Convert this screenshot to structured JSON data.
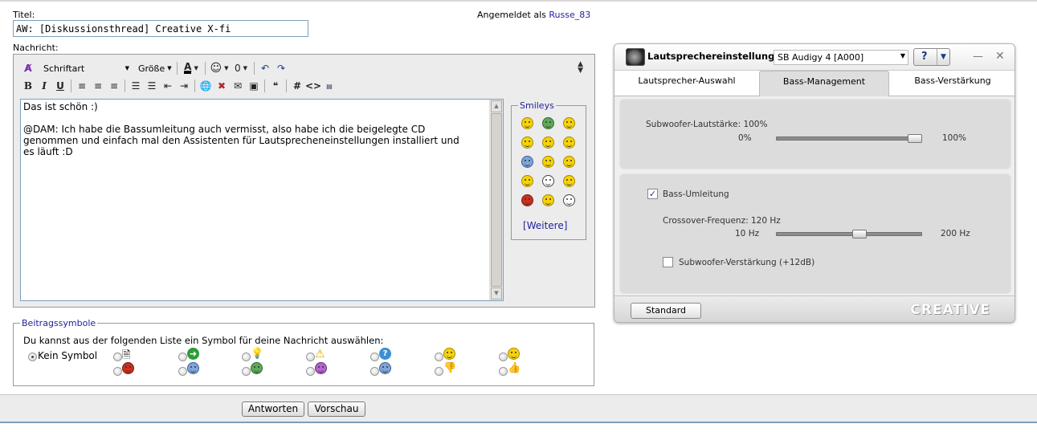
{
  "form": {
    "title_label": "Titel:",
    "title_value": "AW: [Diskussionsthread] Creative X-fi",
    "message_label": "Nachricht:",
    "logged_in_prefix": "Angemeldet als",
    "username": "Russe_83"
  },
  "toolbar": {
    "font_label": "Schriftart",
    "size_label": "Größe",
    "code_hash": "#",
    "code_tags": "<>"
  },
  "message": {
    "lines": [
      "Das ist schön :)",
      "",
      "@DAM: Ich habe die Bassumleitung auch vermisst, also habe ich die beigelegte CD",
      "genommen und einfach mal den Assistenten für Lautsprecheneinstellungen installiert und",
      "es läuft :D"
    ]
  },
  "smileys": {
    "legend": "Smileys",
    "more_bracket_open": "[",
    "more_label": "Weitere",
    "more_bracket_close": "]"
  },
  "post_icons": {
    "legend": "Beitragssymbole",
    "description": "Du kannst aus der folgenden Liste ein Symbol für deine Nachricht auswählen:",
    "no_symbol_label": "Kein Symbol"
  },
  "buttons": {
    "reply": "Antworten",
    "preview": "Vorschau"
  },
  "speaker_window": {
    "title": "Lautsprechereinstellungen",
    "device": "SB Audigy 4 [A000]",
    "help": "?",
    "tabs": [
      "Lautsprecher-Auswahl",
      "Bass-Management",
      "Bass-Verstärkung"
    ],
    "active_tab": "Bass-Management",
    "subwoofer_volume_label": "Subwoofer-Lautstärke: 100%",
    "subwoofer_min": "0%",
    "subwoofer_max": "100%",
    "subwoofer_level": 1.0,
    "bass_redirect_label": "Bass-Umleitung",
    "bass_redirect_checked": true,
    "crossover_label": "Crossover-Frequenz: 120 Hz",
    "crossover_min": "10 Hz",
    "crossover_max": "200 Hz",
    "crossover_hz": 120,
    "sub_boost_label": "Subwoofer-Verstärkung (+12dB)",
    "sub_boost_checked": false,
    "standard_button": "Standard",
    "brand": "CREATIVE"
  },
  "colors": {
    "link": "#22229c",
    "toolbar_bg": "#ececec",
    "input_border": "#7f9db9"
  }
}
